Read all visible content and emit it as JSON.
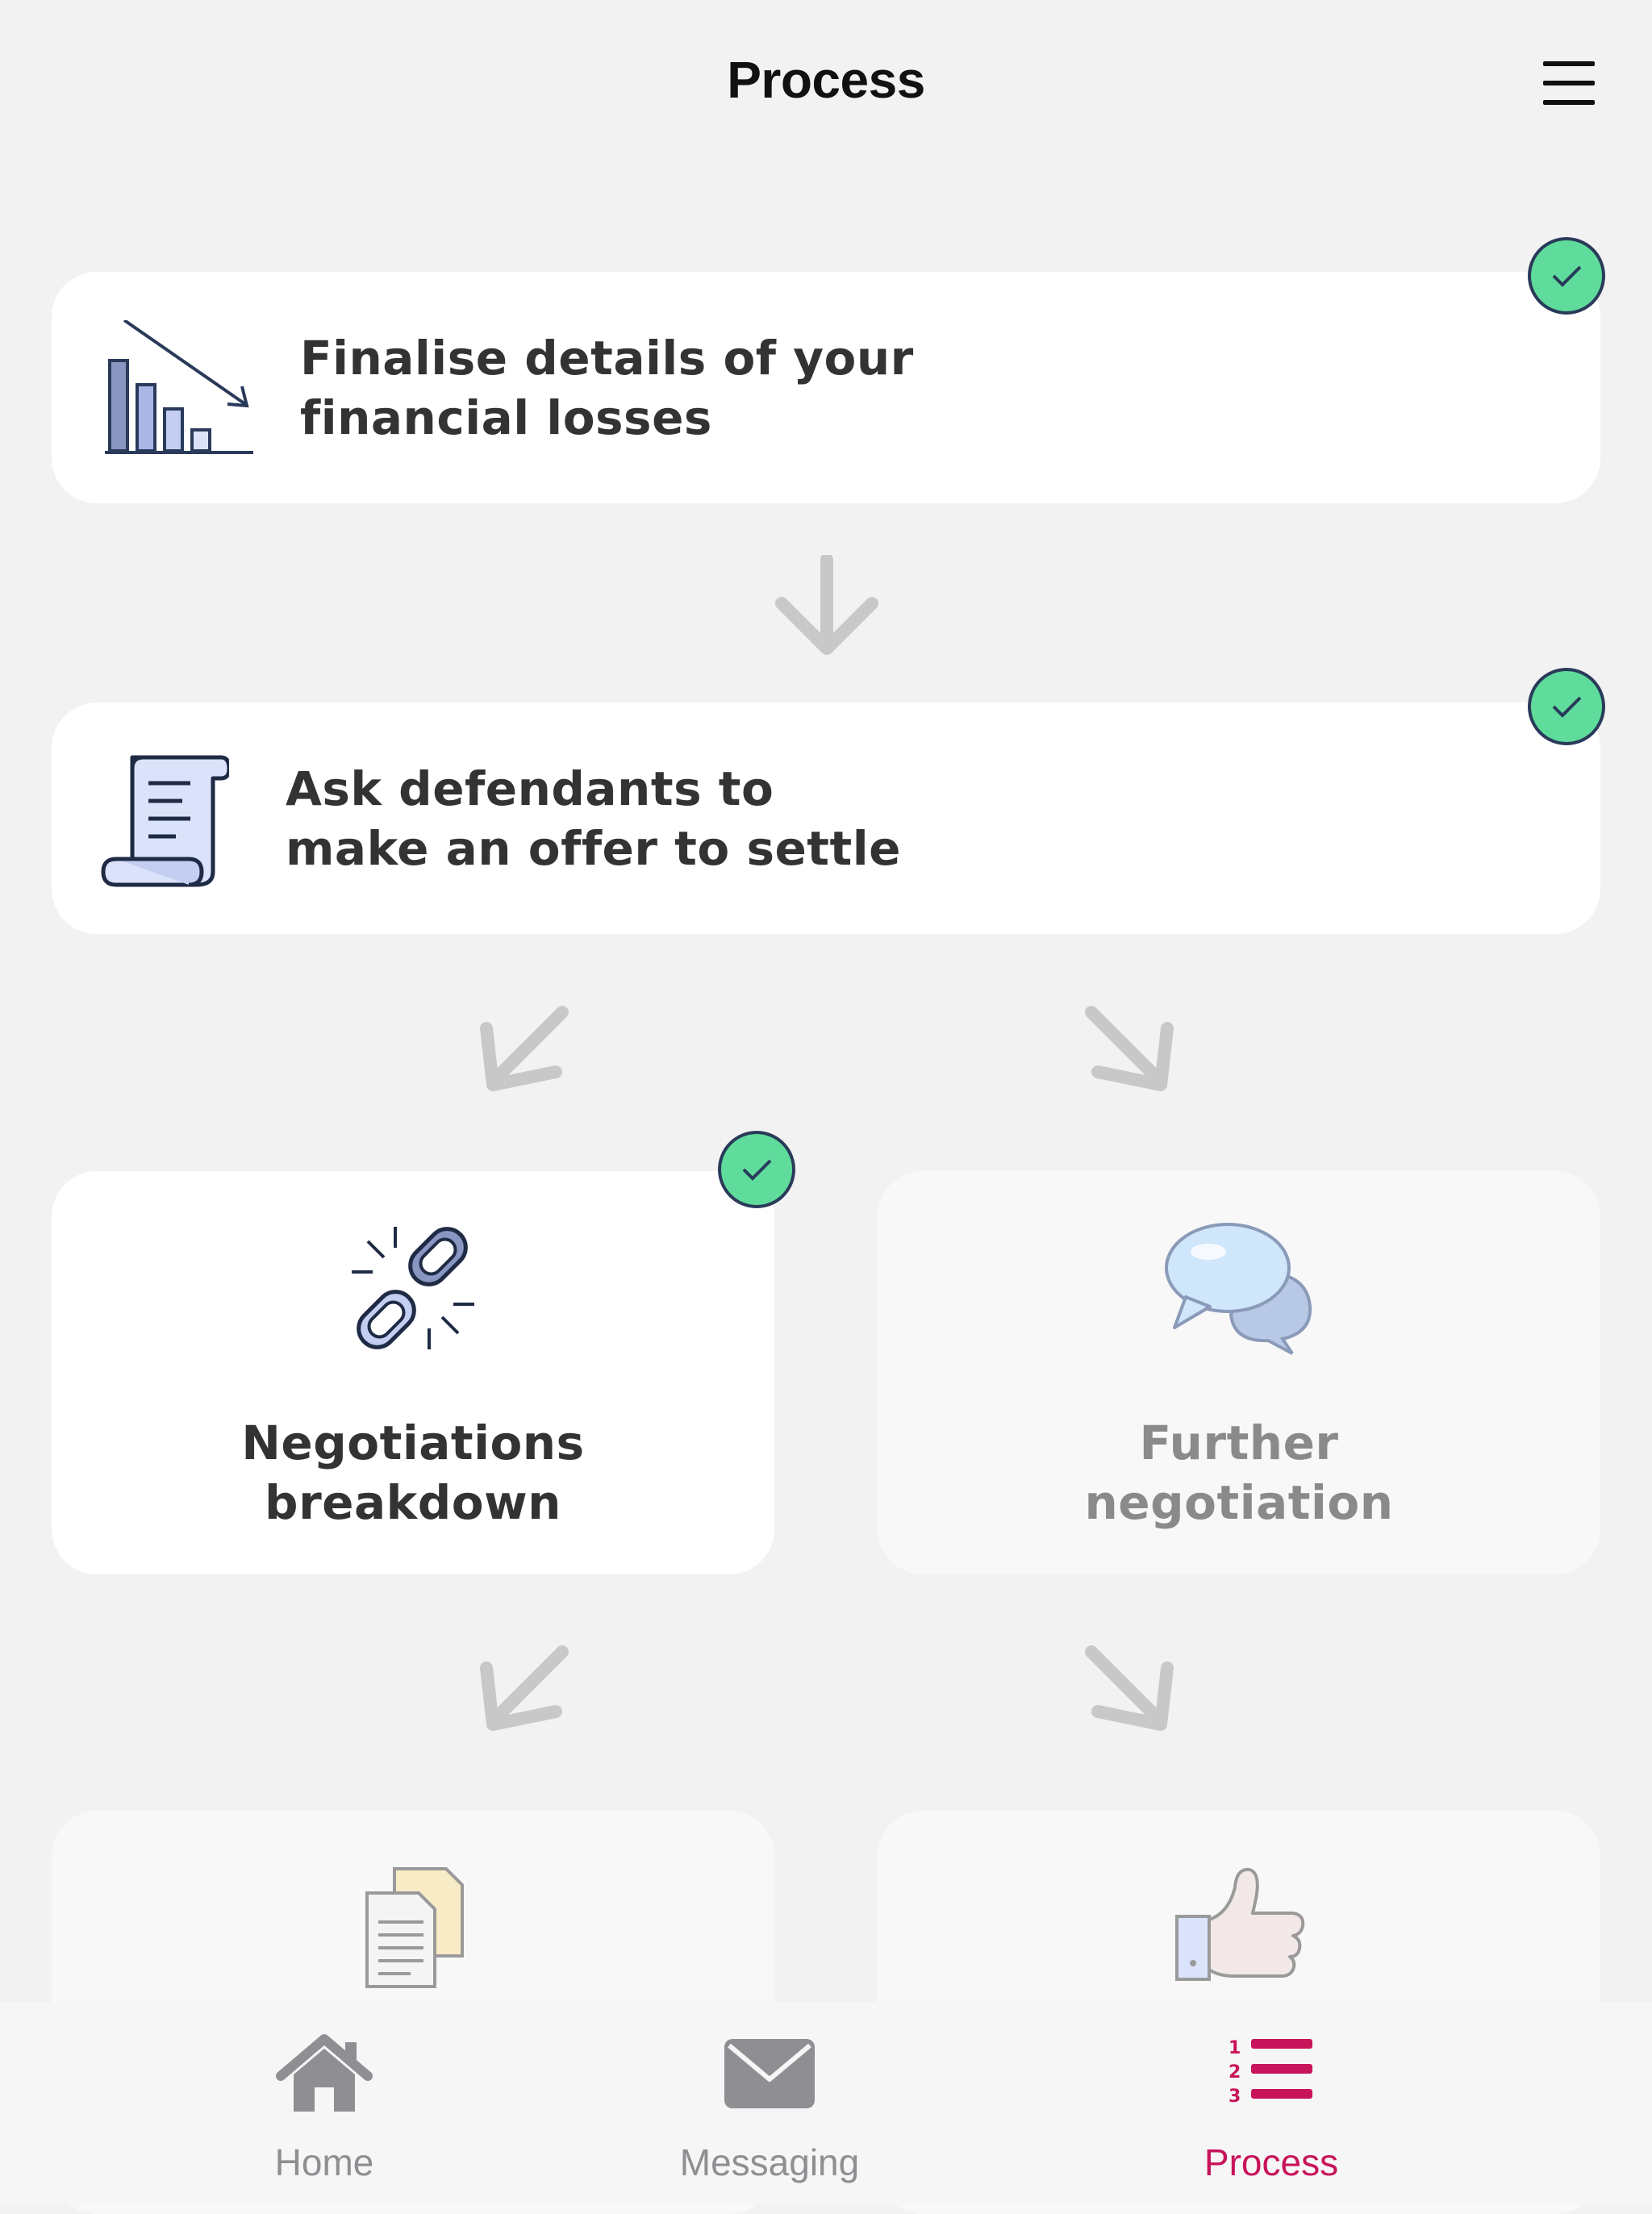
{
  "header": {
    "title": "Process",
    "menu_icon": "hamburger-menu-icon"
  },
  "steps": [
    {
      "label_line1": "Finalise details of your",
      "label_line2": "financial losses",
      "completed": true,
      "icon": "declining-bar-chart-icon"
    },
    {
      "label_line1": "Ask defendants to",
      "label_line2": "make an offer to settle",
      "completed": true,
      "icon": "scroll-document-icon"
    },
    {
      "label_line1": "Negotiations",
      "label_line2": "breakdown",
      "completed": true,
      "icon": "broken-chain-icon"
    },
    {
      "label_line1": "Further",
      "label_line2": "negotiation",
      "completed": false,
      "icon": "speech-bubbles-icon"
    },
    {
      "completed": false,
      "icon": "documents-icon"
    },
    {
      "completed": false,
      "icon": "thumbs-up-icon"
    }
  ],
  "tabs": [
    {
      "label": "Home",
      "icon": "home-icon",
      "active": false
    },
    {
      "label": "Messaging",
      "icon": "envelope-icon",
      "active": false
    },
    {
      "label": "Process",
      "icon": "numbered-list-icon",
      "active": true
    }
  ],
  "colors": {
    "background": "#f2f2f2",
    "card": "#ffffff",
    "card_inactive": "#f8f8f8",
    "check_green": "#5fdc9b",
    "accent_active": "#c8145a",
    "tab_inactive": "#8e8e93",
    "arrow_gray": "#c8c8c8"
  }
}
